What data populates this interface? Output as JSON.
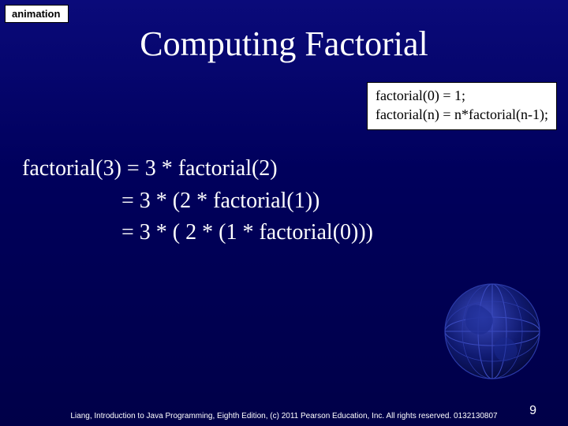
{
  "badge": {
    "label": "animation"
  },
  "title": "Computing Factorial",
  "rules": {
    "line1": "factorial(0) = 1;",
    "line2": "factorial(n) = n*factorial(n-1);"
  },
  "derivation": {
    "line1": "factorial(3) = 3 * factorial(2)",
    "line2": "                  = 3 * (2 * factorial(1))",
    "line3": "                  = 3 * ( 2 * (1 * factorial(0)))"
  },
  "footer": {
    "text": "Liang, Introduction to Java Programming, Eighth Edition, (c) 2011 Pearson Education, Inc. All rights reserved. 0132130807"
  },
  "page_number": "9"
}
